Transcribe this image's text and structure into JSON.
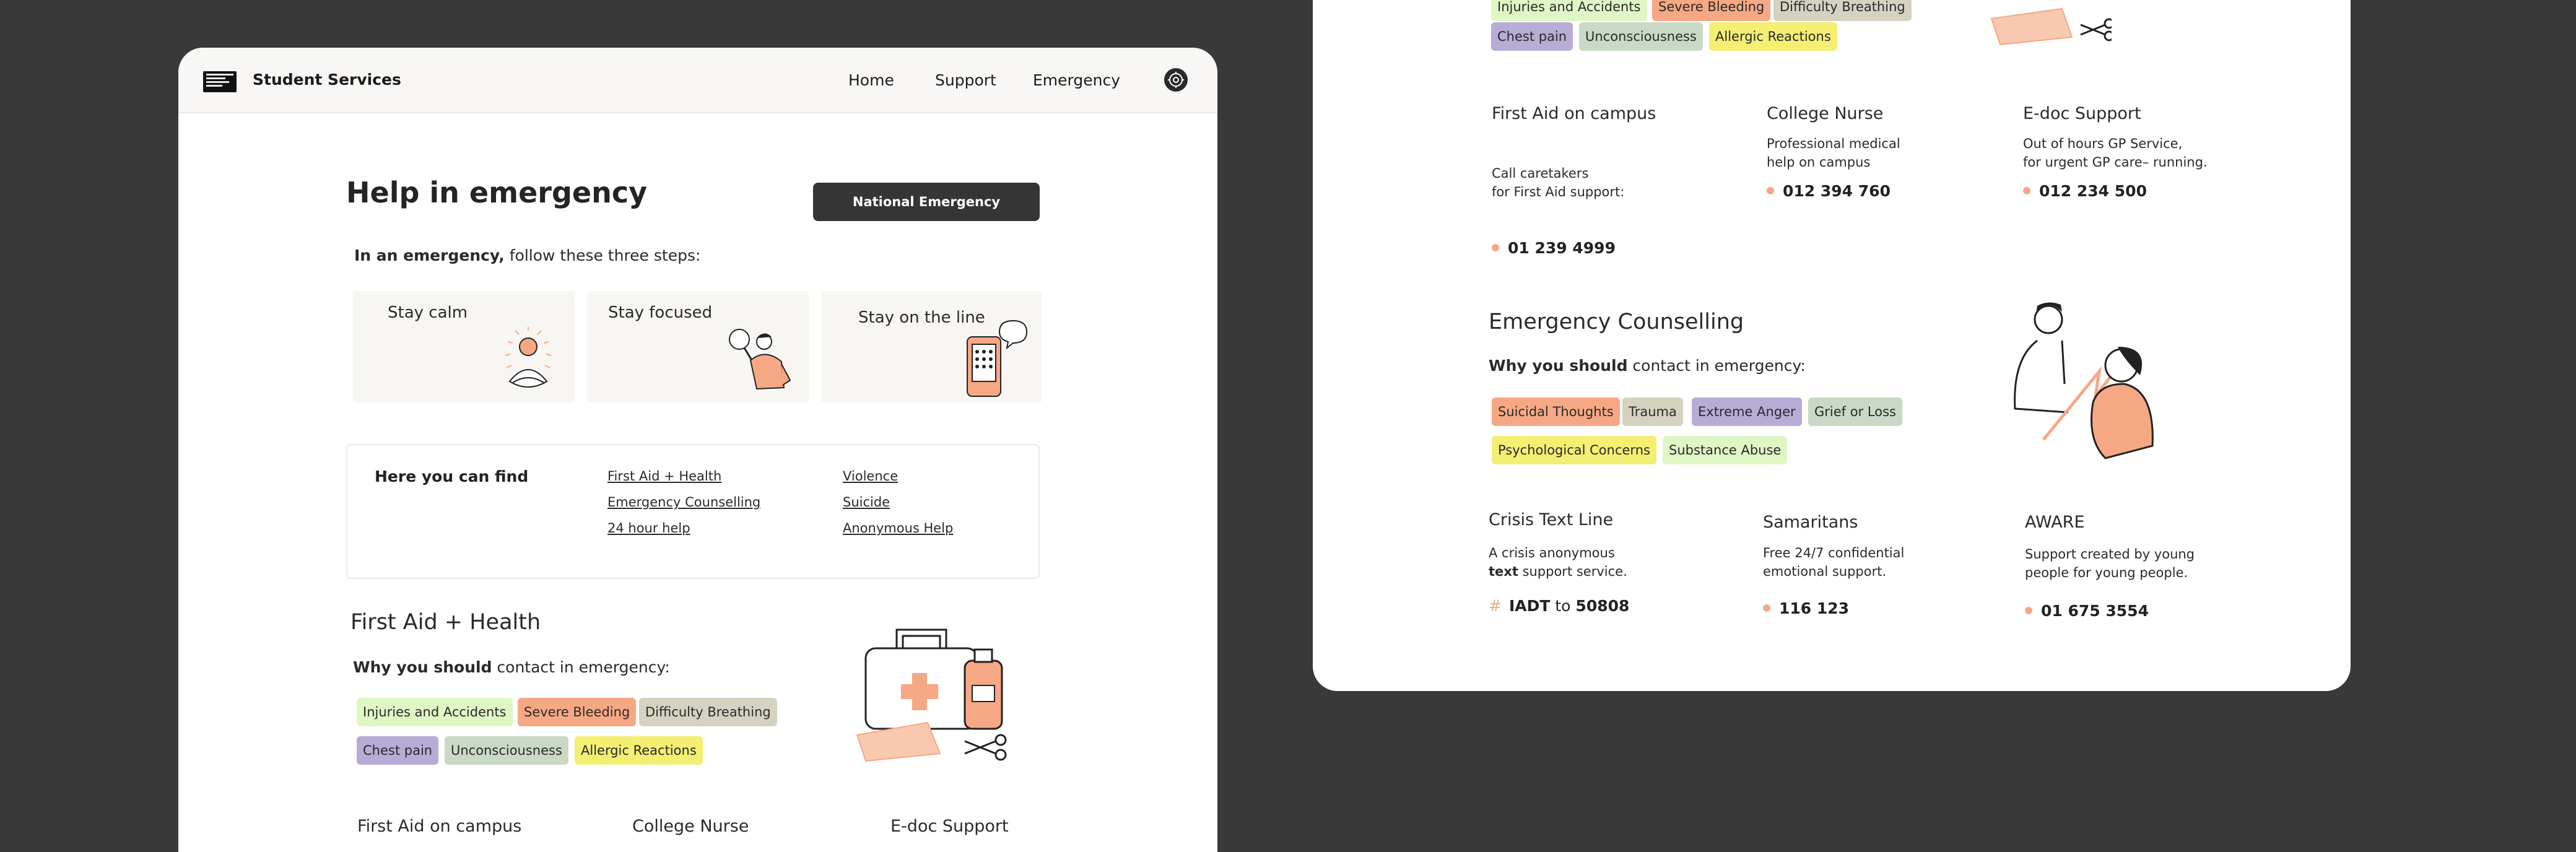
{
  "nav": {
    "brand": "Student Services",
    "links": [
      "Home",
      "Support",
      "Emergency"
    ]
  },
  "hero": {
    "title": "Help in emergency",
    "cta": "National Emergency",
    "intro_bold": "In an emergency,",
    "intro_rest": " follow these three steps:"
  },
  "steps": [
    "Stay calm",
    "Stay focused",
    "Stay on the line"
  ],
  "find": {
    "title": "Here you can find",
    "links": [
      "First Aid + Health",
      "Emergency Counselling",
      "24 hour help",
      "Violence",
      "Suicide",
      "Anonymous Help"
    ]
  },
  "first_aid": {
    "title": "First Aid + Health",
    "why_bold": "Why you should",
    "why_rest": " contact in emergency:",
    "tags": [
      "Injuries and Accidents",
      "Severe Bleeding",
      "Difficulty Breathing",
      "Chest pain",
      "Unconsciousness",
      "Allergic Reactions"
    ],
    "services": [
      {
        "title": "First Aid on campus",
        "desc1": "Call caretakers",
        "desc2": "for First Aid support:",
        "phone": "01 239 4999"
      },
      {
        "title": "College Nurse",
        "desc1": "Professional medical",
        "desc2": "help on campus",
        "phone": "012 394 760"
      },
      {
        "title": "E-doc Support",
        "desc1": "Out of hours GP Service,",
        "desc2": "for urgent GP care– running.",
        "phone": "012 234 500"
      }
    ]
  },
  "counselling": {
    "title": "Emergency Counselling",
    "why_bold": "Why you should",
    "why_rest": " contact in emergency:",
    "tags": [
      "Suicidal Thoughts",
      "Trauma",
      "Extreme Anger",
      "Grief or Loss",
      "Psychological Concerns",
      "Substance Abuse"
    ],
    "services": [
      {
        "title": "Crisis Text Line",
        "desc1": "A crisis anonymous",
        "desc2_bold": "text",
        "desc2_rest": " support service.",
        "phone_pre": "IADT",
        "phone_mid": " to ",
        "phone_num": "50808"
      },
      {
        "title": "Samaritans",
        "desc1": "Free 24/7 confidential",
        "desc2": "emotional support.",
        "phone": "116 123"
      },
      {
        "title": "AWARE",
        "desc1": "Support created by young",
        "desc2": "people for young people.",
        "phone": "01 675 3554"
      }
    ]
  },
  "colors": {
    "background": "#393939",
    "accent": "#f6a884",
    "button": "#353535"
  }
}
